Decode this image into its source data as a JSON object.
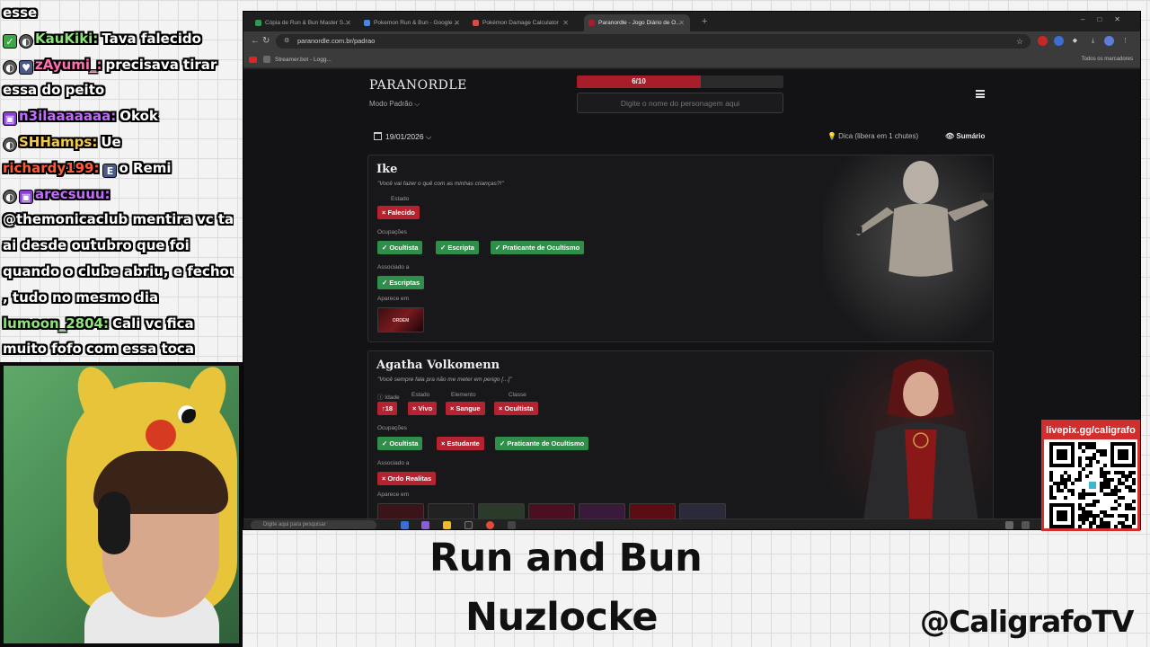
{
  "chat": {
    "messages": [
      {
        "user": "",
        "text": "esse",
        "badges": []
      },
      {
        "user": "KauKiki:",
        "text": "Tava falecido",
        "badges": [
          "check",
          "mic"
        ],
        "user_color": "#8ee37a"
      },
      {
        "user": "zAyumi_:",
        "text": "precisava tirar",
        "badges": [
          "mic",
          "sub"
        ],
        "user_color": "#ff6fb1"
      },
      {
        "user": "",
        "text": "essa do peito",
        "badges": []
      },
      {
        "user": "n3ilaaaaaaa:",
        "text": "Okok",
        "badges": [
          "purple"
        ],
        "user_color": "#c46bff"
      },
      {
        "user": "SHHamps:",
        "text": "Ue",
        "badges": [
          "mic"
        ],
        "user_color": "#f2c94c"
      },
      {
        "user": "richardy199:",
        "text": "o Remi",
        "badges": [],
        "user_color": "#ff5a3c",
        "emote_after_user": true
      },
      {
        "user": "arecsuuu:",
        "text": "",
        "badges": [
          "mic",
          "purple"
        ],
        "user_color": "#c46bff"
      },
      {
        "user": "",
        "text": "@themonicaclub mentira vc ta",
        "badges": []
      },
      {
        "user": "",
        "text": "ai desde outubro que foi",
        "badges": []
      },
      {
        "user": "",
        "text": "quando o clube abriu, e fechou",
        "badges": []
      },
      {
        "user": "",
        "text": ", tudo no mesmo dia",
        "badges": []
      },
      {
        "user": "lumoon_2804:",
        "text": "Cali vc fica",
        "badges": [],
        "user_color": "#8ee37a"
      },
      {
        "user": "",
        "text": "muito fofo com essa toca",
        "badges": []
      }
    ]
  },
  "browser": {
    "tabs": [
      {
        "label": "Cópia de Run & Bun Master S...",
        "active": false,
        "favicon_color": "#2f9a55"
      },
      {
        "label": "Pokemon Run & Bun - Google ...",
        "active": false,
        "favicon_color": "#4a86e8"
      },
      {
        "label": "Pokémon Damage Calculator",
        "active": false,
        "favicon_color": "#d84b4b"
      },
      {
        "label": "Paranordle - Jogo Diário de O...",
        "active": true,
        "favicon_color": "#a71d2a"
      }
    ],
    "new_tab": "+",
    "url": "paranordle.com.br/padrao",
    "bookmark_1": "Streamer.bot - Logg...",
    "bookmark_all": "Todos os marcadores"
  },
  "site": {
    "logo": "PARANORDLE",
    "mode": "Modo Padrão ⌵",
    "attempts": "6/10",
    "attempts_fraction": 0.6,
    "guess_placeholder": "Digite o nome do personagem aqui",
    "date": "19/01/2026 ⌵",
    "hint": "💡 Dica (libera em 1 chutes)",
    "summary": "👁 Sumário"
  },
  "cards": [
    {
      "name": "Ike",
      "quote": "\"Você vai fazer o quê com as minhas crianças?!\"",
      "status_label": "Estado",
      "status": "× Falecido",
      "occupations_label": "Ocupações",
      "occupations": [
        "✓ Ocultista",
        "✓ Escripta",
        "✓ Praticante de Ocultismo"
      ],
      "associated_label": "Associado a",
      "associated": "✓ Escriptas",
      "appears_label": "Aparece em",
      "appears": [
        "ORDEM PARANORMAL"
      ]
    },
    {
      "name": "Agatha Volkomenn",
      "quote": "\"Você sempre fala pra não me meter em perigo [...]\"",
      "age_label": "ⓘ Idade",
      "status_label": "Estado",
      "element_label": "Elemento",
      "class_label": "Classe",
      "age": "↑18",
      "status": "× Vivo",
      "element": "× Sangue",
      "class": "× Ocultista",
      "occupations_label": "Ocupações",
      "occupations": [
        "✓ Ocultista",
        "× Estudante",
        "✓ Praticante de Ocultismo"
      ],
      "associated_label": "Associado a",
      "associated": "× Ordo Realitas",
      "appears_label": "Aparece em"
    }
  ],
  "taskbar": {
    "search": "Digite aqui para pesquisar"
  },
  "overlay": {
    "title_line1": "Run and Bun",
    "title_line2": "Nuzlocke",
    "handle": "@CaligrafoTV",
    "qr_label": "livepix.gg/caligrafo"
  },
  "colors": {
    "accent_red": "#a71d2a",
    "chip_green": "#2f8f4a",
    "chip_red": "#b4232f",
    "qr_border": "#d12e2e"
  }
}
